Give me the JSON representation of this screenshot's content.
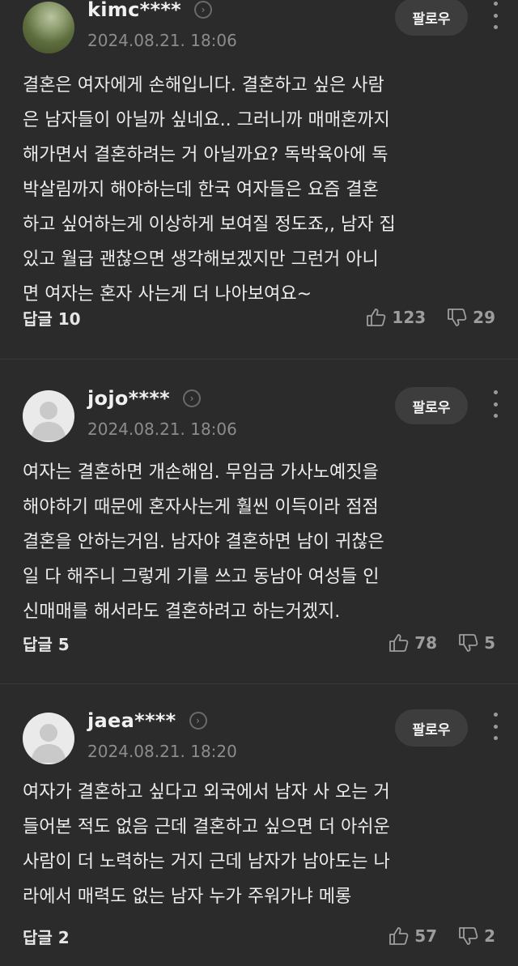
{
  "follow_label": "팔로우",
  "comments": [
    {
      "username": "kimc****",
      "date": "2024.08.21. 18:06",
      "avatar": "landscape-photo",
      "text": "결혼은 여자에게 손해입니다. 결혼하고 싶은 사람\n은 남자들이 아닐까 싶네요.. 그러니까 매매혼까지\n해가면서 결혼하려는 거 아닐까요? 독박육아에 독\n박살림까지 해야하는데 한국 여자들은 요즘 결혼\n하고 싶어하는게 이상하게 보여질 정도죠,, 남자 집\n있고 월급 괜찮으면 생각해보겠지만 그런거 아니\n면 여자는 혼자 사는게 더 나아보여요~",
      "reply": "답글 10",
      "likes": "123",
      "dislikes": "29"
    },
    {
      "username": "jojo****",
      "date": "2024.08.21. 18:06",
      "avatar": "default-avatar",
      "text": "여자는 결혼하면 개손해임. 무임금 가사노예짓을\n해야하기 때문에 혼자사는게 훨씬 이득이라 점점\n결혼을 안하는거임. 남자야 결혼하면 남이 귀찮은\n일 다 해주니 그렇게 기를 쓰고 동남아 여성들 인\n신매매를 해서라도 결혼하려고 하는거겠지.",
      "reply": "답글 5",
      "likes": "78",
      "dislikes": "5"
    },
    {
      "username": "jaea****",
      "date": "2024.08.21. 18:20",
      "avatar": "default-avatar",
      "text": "여자가 결혼하고 싶다고 외국에서 남자 사 오는 거\n들어본 적도 없음 근데 결혼하고 싶으면 더 아쉬운\n사람이 더 노력하는 거지 근데 남자가 남아도는 나\n라에서 매력도 없는 남자 누가 주워가냐 메롱",
      "reply": "답글 2",
      "likes": "57",
      "dislikes": "2"
    }
  ]
}
